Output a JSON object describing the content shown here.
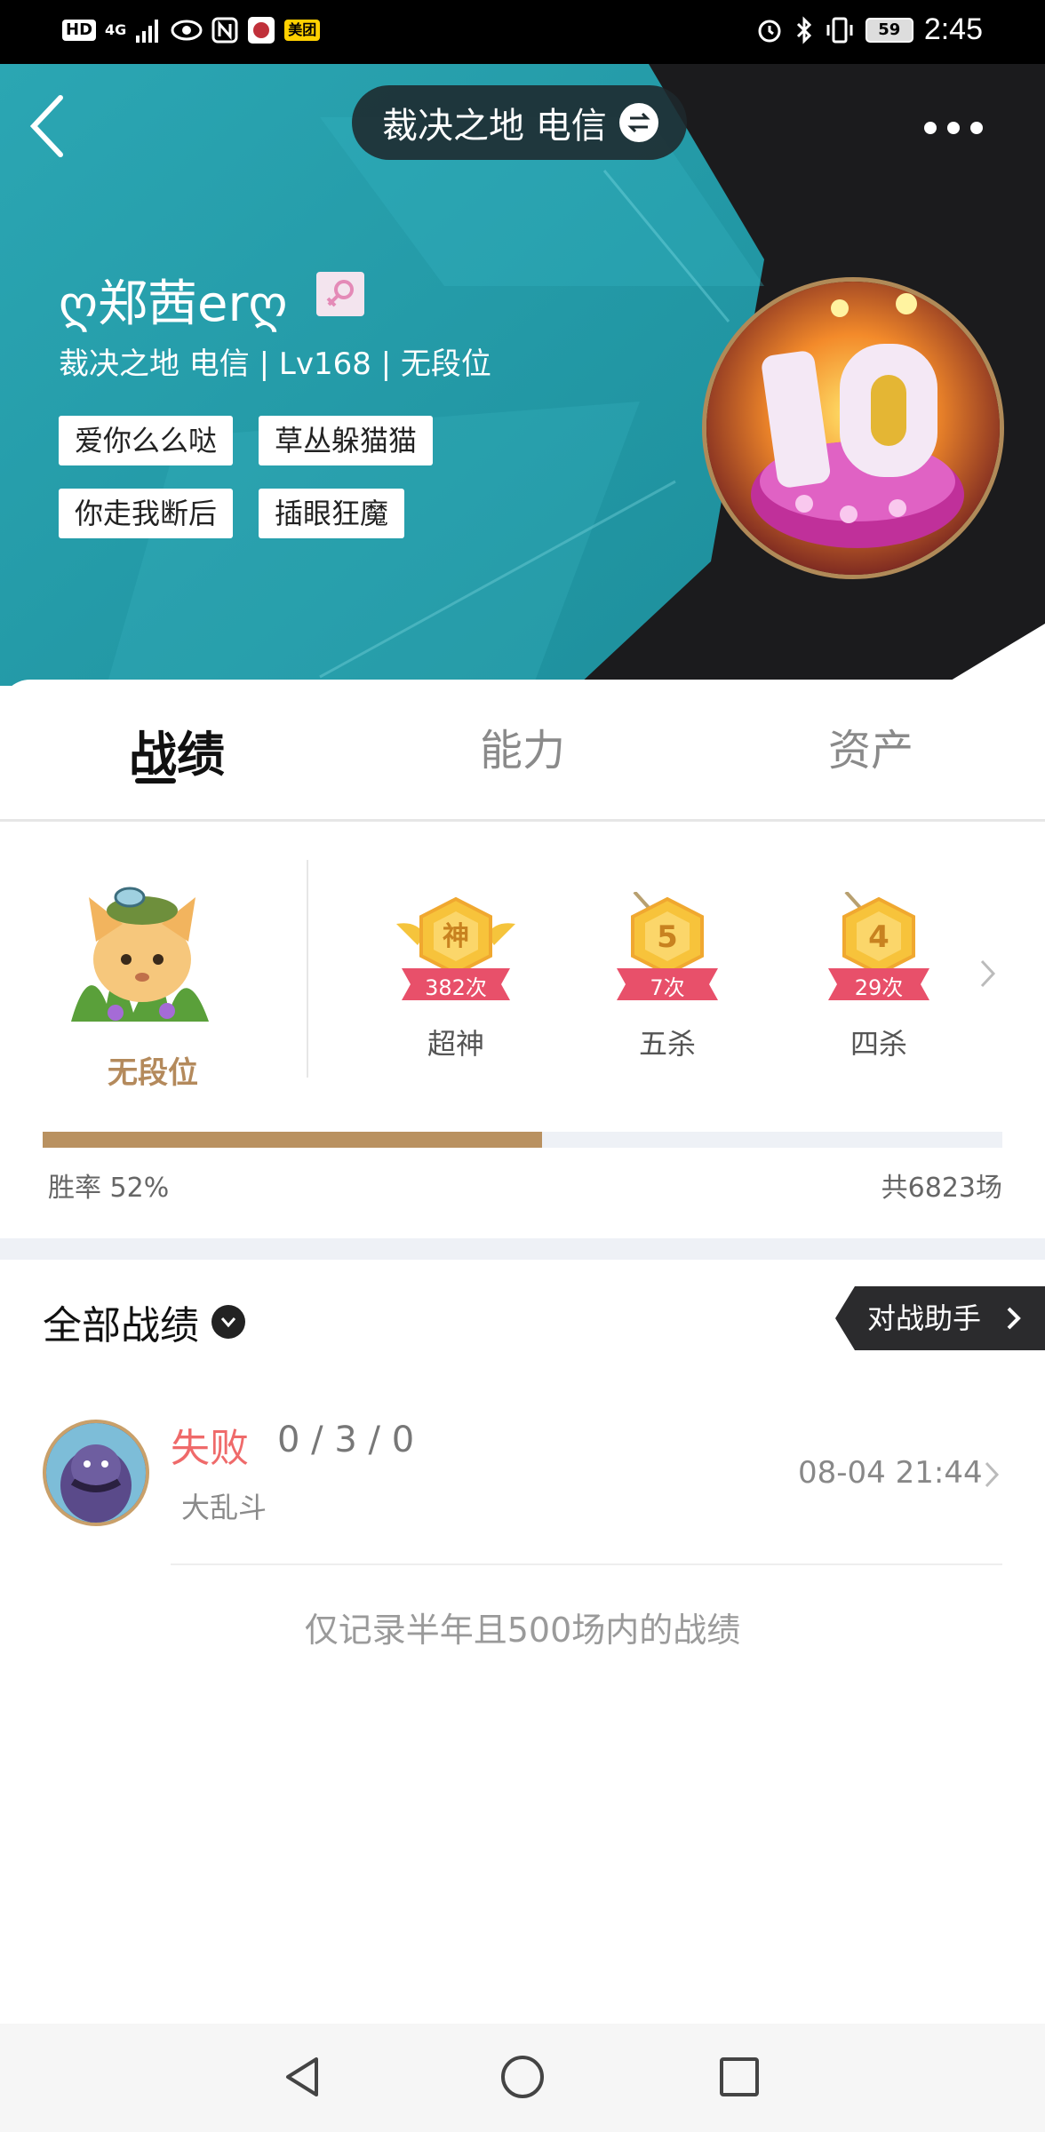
{
  "status_bar": {
    "left_icons": [
      "HD",
      "4G",
      "signal-icon",
      "eye-icon",
      "nfc-icon",
      "app-icon",
      "美团"
    ],
    "right_icons": [
      "alarm-icon",
      "bluetooth-icon",
      "vibrate-icon"
    ],
    "battery": "59",
    "time": "2:45"
  },
  "header": {
    "server": "裁决之地 电信",
    "nickname": "ღ郑茜erღ",
    "gender": "female-icon",
    "subinfo": "裁决之地 电信 | Lv168 | 无段位",
    "tags": [
      "爱你么么哒",
      "草丛躲猫猫",
      "你走我断后",
      "插眼狂魔"
    ],
    "colors": {
      "teal": "#2aa0ad",
      "dark": "#1b1b1d"
    }
  },
  "tabs": [
    {
      "label": "战绩",
      "active": true
    },
    {
      "label": "能力",
      "active": false
    },
    {
      "label": "资产",
      "active": false
    }
  ],
  "stats": {
    "rank": "无段位",
    "badges": [
      {
        "glyph": "神",
        "count": "382次",
        "label": "超神"
      },
      {
        "glyph": "5",
        "count": "7次",
        "label": "五杀"
      },
      {
        "glyph": "4",
        "count": "29次",
        "label": "四杀"
      }
    ],
    "win_rate_label": "胜率  52%",
    "win_rate_value": 0.52,
    "total_games": "共6823场",
    "colors": {
      "progress": "#b99160",
      "rank_text": "#b48a5c"
    }
  },
  "matches_section": {
    "title": "全部战绩",
    "assist_button": "对战助手",
    "matches": [
      {
        "result": "失败",
        "kda": "0 / 3 / 0",
        "mode": "大乱斗",
        "time": "08-04 21:44"
      }
    ],
    "note": "仅记录半年且500场内的战绩"
  },
  "nav_bar": [
    "back-icon",
    "home-icon",
    "recents-icon"
  ]
}
